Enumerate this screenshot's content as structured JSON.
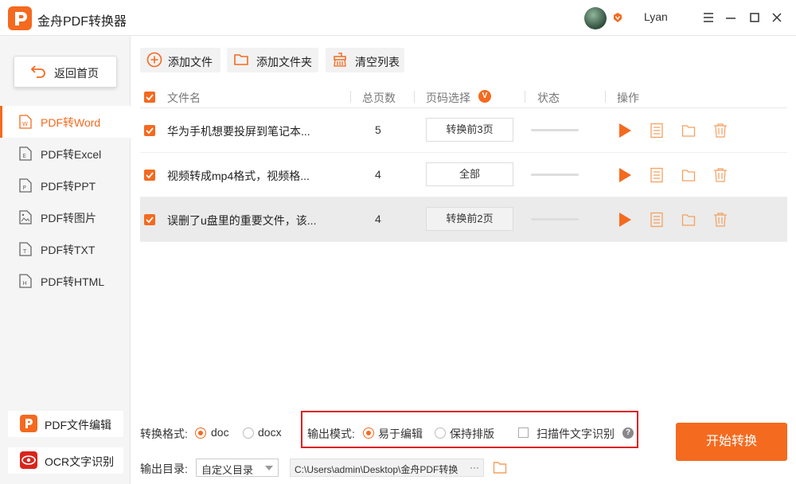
{
  "app": {
    "title": "金舟PDF转换器",
    "username": "Lyan",
    "accent": "#f46a1f"
  },
  "sidebar": {
    "back_label": "返回首页",
    "items": [
      {
        "label": "PDF转Word",
        "icon": "word-file-icon",
        "active": true
      },
      {
        "label": "PDF转Excel",
        "icon": "excel-file-icon",
        "active": false
      },
      {
        "label": "PDF转PPT",
        "icon": "ppt-file-icon",
        "active": false
      },
      {
        "label": "PDF转图片",
        "icon": "image-file-icon",
        "active": false
      },
      {
        "label": "PDF转TXT",
        "icon": "txt-file-icon",
        "active": false
      },
      {
        "label": "PDF转HTML",
        "icon": "html-file-icon",
        "active": false
      }
    ],
    "tools": [
      {
        "label": "PDF文件编辑",
        "icon": "pdf-edit-icon"
      },
      {
        "label": "OCR文字识别",
        "icon": "ocr-eye-icon"
      }
    ]
  },
  "toolbar": {
    "add_file": "添加文件",
    "add_folder": "添加文件夹",
    "clear_list": "清空列表"
  },
  "table": {
    "headers": {
      "filename": "文件名",
      "pages": "总页数",
      "page_select": "页码选择",
      "page_select_badge": "V",
      "status": "状态",
      "actions": "操作"
    },
    "rows": [
      {
        "name": "华为手机想要投屏到笔记本...",
        "pages": "5",
        "selection": "转换前3页",
        "checked": true
      },
      {
        "name": "视频转成mp4格式，视频格...",
        "pages": "4",
        "selection": "全部",
        "checked": true
      },
      {
        "name": "误删了u盘里的重要文件，该...",
        "pages": "4",
        "selection": "转换前2页",
        "checked": true
      }
    ]
  },
  "bottom": {
    "format_label": "转换格式:",
    "format_options": [
      "doc",
      "docx"
    ],
    "format_selected": "doc",
    "output_mode_label": "输出模式:",
    "mode_options": [
      "易于编辑",
      "保持排版"
    ],
    "mode_selected": "易于编辑",
    "ocr_checkbox_label": "扫描件文字识别",
    "help_glyph": "?",
    "output_dir_label": "输出目录:",
    "output_dir_option": "自定义目录",
    "output_path": "C:\\Users\\admin\\Desktop\\金舟PDF转换",
    "path_more": "···",
    "start_button": "开始转换"
  }
}
